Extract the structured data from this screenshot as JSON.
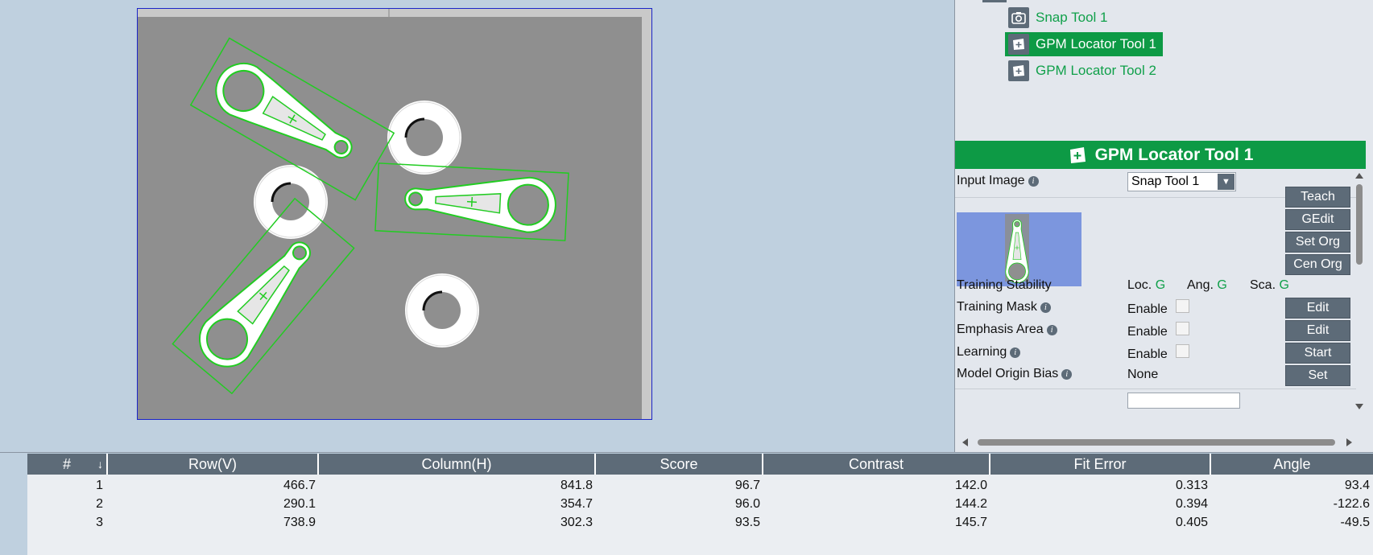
{
  "tree": {
    "items": [
      {
        "label": "Snap Tool 1",
        "icon": "camera-icon",
        "selected": false
      },
      {
        "label": "GPM Locator Tool 1",
        "icon": "locator-tool-icon",
        "selected": true
      },
      {
        "label": "GPM Locator Tool 2",
        "icon": "locator-tool-icon",
        "selected": false
      }
    ]
  },
  "props": {
    "title": "GPM Locator Tool 1",
    "input_image_label": "Input Image",
    "input_image_value": "Snap Tool 1",
    "buttons": {
      "teach": "Teach",
      "gedit": "GEdit",
      "set_org": "Set Org",
      "cen_org": "Cen Org"
    },
    "training_stability": {
      "label": "Training Stability",
      "loc_label": "Loc.",
      "loc_value": "G",
      "ang_label": "Ang.",
      "ang_value": "G",
      "sca_label": "Sca.",
      "sca_value": "G"
    },
    "training_mask": {
      "label": "Training Mask",
      "enable_label": "Enable",
      "button": "Edit"
    },
    "emphasis_area": {
      "label": "Emphasis Area",
      "enable_label": "Enable",
      "button": "Edit"
    },
    "learning": {
      "label": "Learning",
      "enable_label": "Enable",
      "button": "Start"
    },
    "model_origin_bias": {
      "label": "Model Origin Bias",
      "value": "None",
      "button": "Set"
    },
    "info_glyph": "i"
  },
  "results": {
    "columns": [
      "#",
      "Row(V)",
      "Column(H)",
      "Score",
      "Contrast",
      "Fit Error",
      "Angle"
    ],
    "rows": [
      [
        "1",
        "466.7",
        "841.8",
        "96.7",
        "142.0",
        "0.313",
        "93.4"
      ],
      [
        "2",
        "290.1",
        "354.7",
        "96.0",
        "144.2",
        "0.394",
        "-122.6"
      ],
      [
        "3",
        "738.9",
        "302.3",
        "93.5",
        "145.7",
        "0.405",
        "-49.5"
      ]
    ]
  },
  "colors": {
    "accent_green": "#0d9a45",
    "match_outline": "#22cc22",
    "header_gray": "#5d6b78",
    "viewer_bg": "#bfd0df",
    "image_bg": "#8f8f8f",
    "frame_blue": "#1a24c8"
  }
}
